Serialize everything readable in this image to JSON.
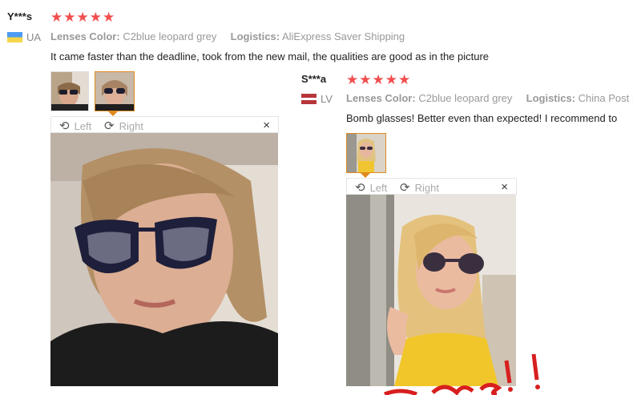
{
  "reviews": [
    {
      "user": "Y***s",
      "stars": "★★★★★",
      "country": "UA",
      "lenses_label": "Lenses Color:",
      "lenses_value": "C2blue leopard grey",
      "logistics_label": "Logistics:",
      "logistics_value": "AliExpress Saver Shipping",
      "text": "It came faster than the deadline, took from the new mail, the qualities are good as in the picture",
      "viewer": {
        "left": "Left",
        "right": "Right",
        "close": "×"
      }
    },
    {
      "user": "S***a",
      "stars": "★★★★★",
      "country": "LV",
      "lenses_label": "Lenses Color:",
      "lenses_value": "C2blue leopard grey",
      "logistics_label": "Logistics:",
      "logistics_value": "China Post Re",
      "text": "Bomb glasses! Better even than expected! I recommend to",
      "viewer": {
        "left": "Left",
        "right": "Right",
        "close": "×"
      }
    }
  ],
  "icons": {
    "rotate_left": "rotate-left-icon",
    "rotate_right": "rotate-right-icon",
    "close": "close-icon"
  },
  "colors": {
    "stars": "#f24e4e",
    "active_border": "#e08a1e"
  }
}
